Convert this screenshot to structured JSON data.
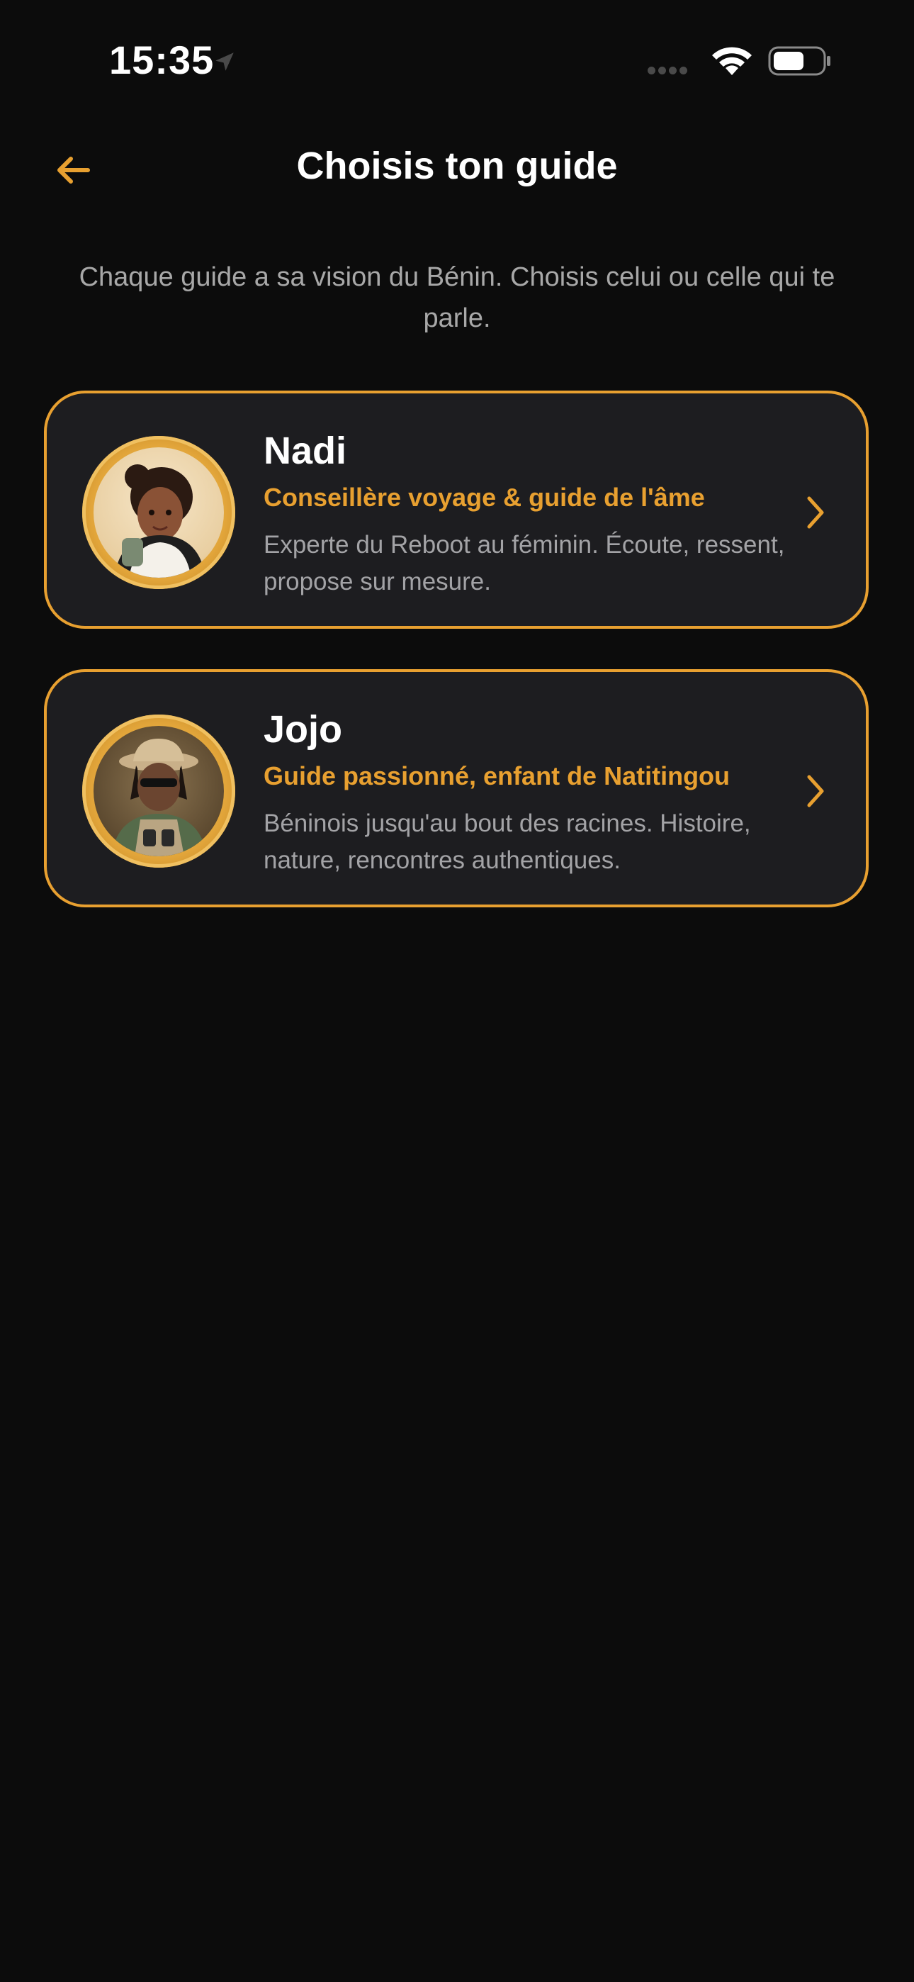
{
  "status_bar": {
    "time": "15:35"
  },
  "header": {
    "title": "Choisis ton guide"
  },
  "subtitle": "Chaque guide a sa vision du Bénin. Choisis celui ou celle qui te parle.",
  "guides": [
    {
      "name": "Nadi",
      "role": "Conseillère voyage & guide de l'âme",
      "description": "Experte du Reboot au féminin. Écoute, ressent, propose sur mesure."
    },
    {
      "name": "Jojo",
      "role": "Guide passionné, enfant de Natitingou",
      "description": "Béninois jusqu'au bout des racines. Histoire, nature, rencontres authentiques."
    }
  ],
  "colors": {
    "background": "#0c0c0c",
    "card_background": "#1d1d20",
    "accent": "#e8a030",
    "text_secondary": "#a8a8a8"
  }
}
